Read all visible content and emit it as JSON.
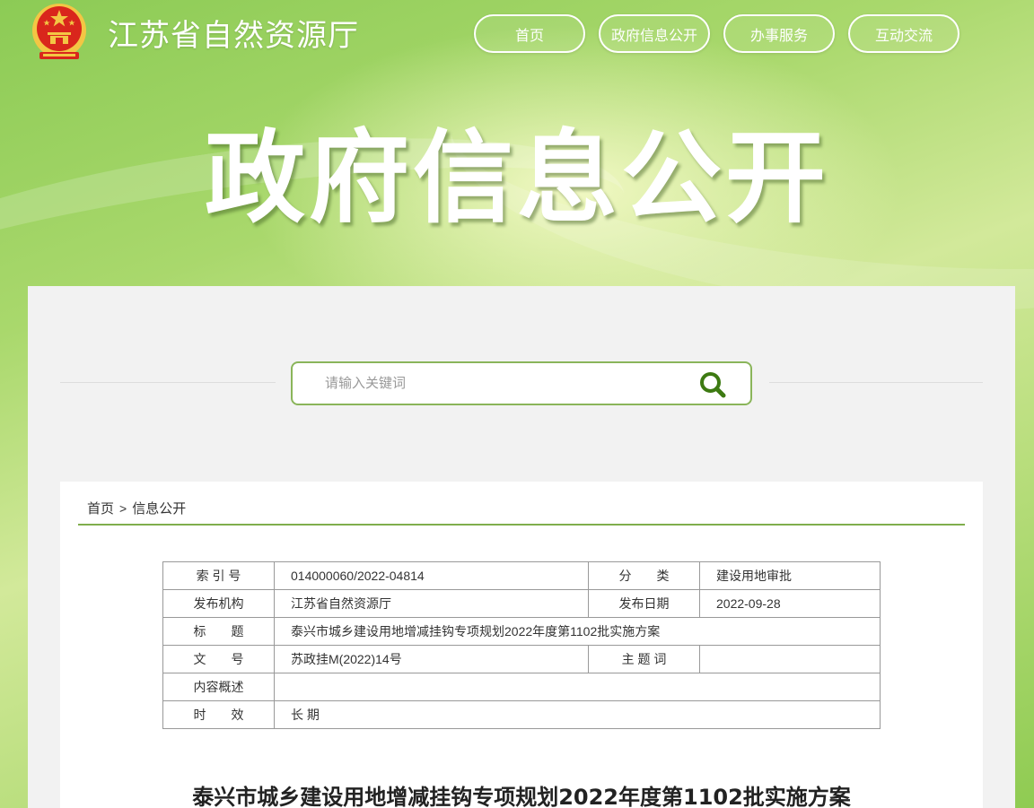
{
  "header": {
    "site_title": "江苏省自然资源厅",
    "banner_title": "政府信息公开",
    "nav": [
      "首页",
      "政府信息公开",
      "办事服务",
      "互动交流"
    ]
  },
  "search": {
    "placeholder": "请输入关键词",
    "icon": "search-icon"
  },
  "breadcrumb": {
    "home": "首页",
    "separator": ">",
    "current": "信息公开"
  },
  "meta_table": {
    "index_label": "索 引 号",
    "index_value": "014000060/2022-04814",
    "category_label": "分　　类",
    "category_value": "建设用地审批",
    "publisher_label": "发布机构",
    "publisher_value": "江苏省自然资源厅",
    "date_label": "发布日期",
    "date_value": "2022-09-28",
    "title_label": "标　　题",
    "title_value": "泰兴市城乡建设用地增减挂钩专项规划2022年度第1102批实施方案",
    "docno_label": "文　　号",
    "docno_value": "苏政挂M(2022)14号",
    "subject_label": "主 题 词",
    "subject_value": "",
    "summary_label": "内容概述",
    "summary_value": "",
    "validity_label": "时　　效",
    "validity_value": "长 期"
  },
  "document": {
    "title": "泰兴市城乡建设用地增减挂钩专项规划2022年度第1102批实施方案"
  },
  "colors": {
    "accent_green": "#7fae4c",
    "search_icon_green": "#3d7a12",
    "emblem_red": "#d9261c",
    "emblem_gold": "#f3c644"
  }
}
